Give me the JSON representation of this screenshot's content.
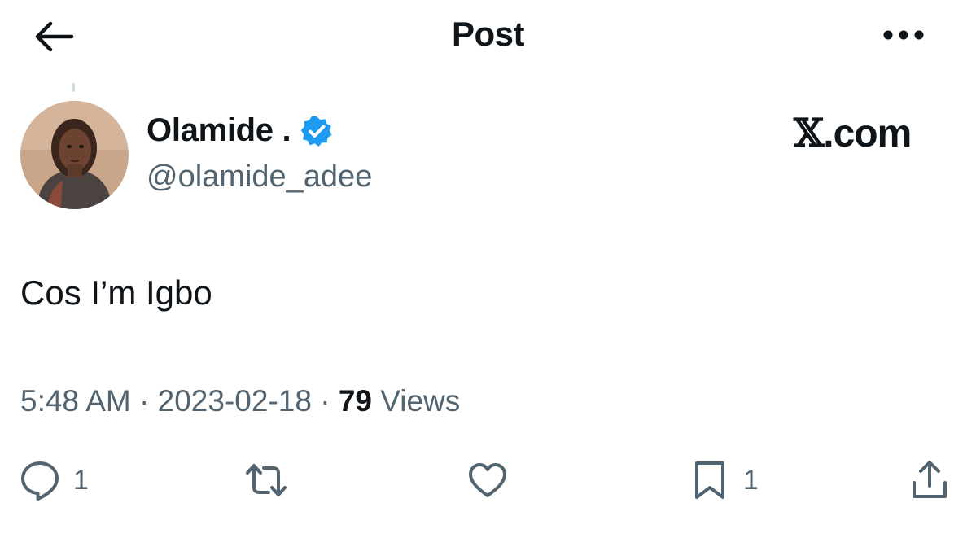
{
  "header": {
    "title": "Post"
  },
  "author": {
    "name": "Olamide .",
    "handle": "@olamide_adee",
    "verified": true
  },
  "watermark": {
    "x_glyph": "𝕏",
    "text": ".com"
  },
  "post": {
    "text": "Cos I’m Igbo",
    "time": "5:48 AM",
    "date": "2023-02-18",
    "separator": "·",
    "views_count": "79",
    "views_label": "Views"
  },
  "actions": {
    "replies": "1",
    "bookmarks": "1"
  },
  "colors": {
    "text": "#0f1419",
    "secondary": "#536471",
    "verified": "#1d9bf0"
  }
}
